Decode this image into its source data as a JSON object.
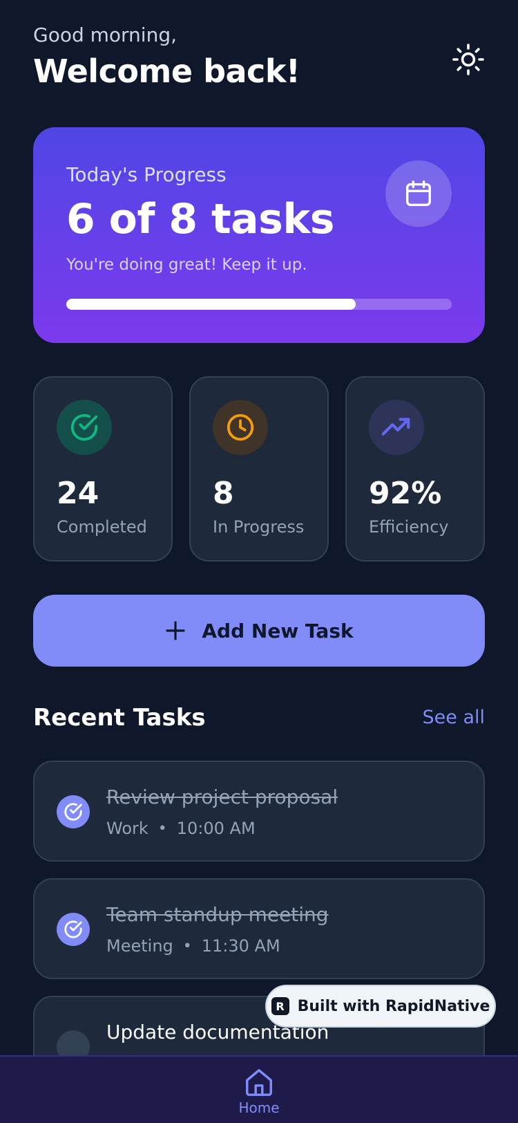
{
  "header": {
    "greeting": "Good morning,",
    "title": "Welcome back!",
    "theme_icon": "sun-icon"
  },
  "progress_card": {
    "title": "Today's Progress",
    "value": "6 of 8 tasks",
    "subtitle": "You're doing great! Keep it up.",
    "icon": "calendar-icon",
    "progress_fraction": 0.75
  },
  "stats": [
    {
      "value": "24",
      "label": "Completed",
      "icon": "check-circle-icon",
      "color": "#10b981"
    },
    {
      "value": "8",
      "label": "In Progress",
      "icon": "clock-icon",
      "color": "#f59e0b"
    },
    {
      "value": "92%",
      "label": "Efficiency",
      "icon": "trending-up-icon",
      "color": "#6366f1"
    }
  ],
  "add_button": {
    "label": "Add New Task",
    "icon": "plus-icon"
  },
  "recent": {
    "title": "Recent Tasks",
    "see_all": "See all",
    "tasks": [
      {
        "title": "Review project proposal",
        "category": "Work",
        "time": "10:00 AM",
        "done": true
      },
      {
        "title": "Team standup meeting",
        "category": "Meeting",
        "time": "11:30 AM",
        "done": true
      },
      {
        "title": "Update documentation",
        "category": "",
        "time": "",
        "done": false
      }
    ]
  },
  "badge": {
    "label": "Built with RapidNative",
    "logo_letter": "R"
  },
  "nav": {
    "home_label": "Home",
    "home_icon": "home-icon"
  },
  "colors": {
    "background": "#0f172a",
    "card": "#1e293b",
    "accent": "#818cf8",
    "gradient_start": "#4f46e5",
    "gradient_end": "#7c3aed"
  }
}
